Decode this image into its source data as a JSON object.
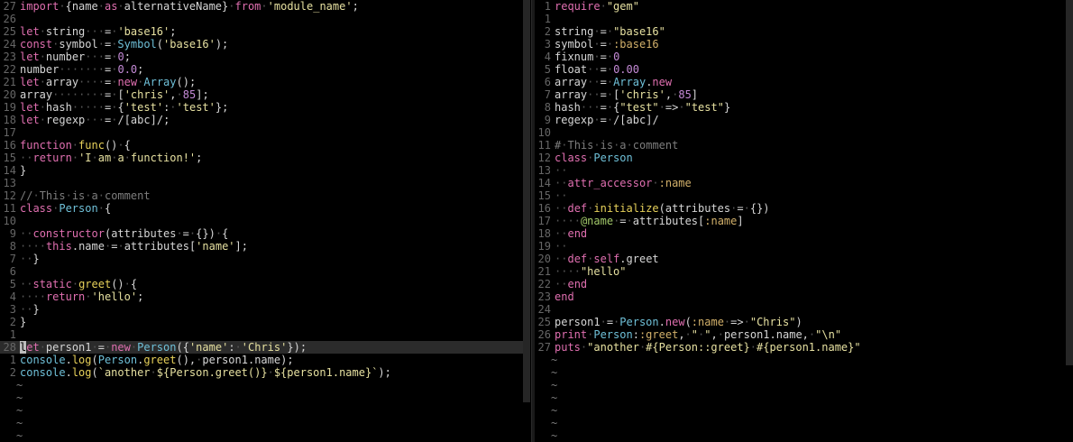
{
  "left_pane": {
    "lines": [
      {
        "n": "27",
        "t": "import·{name·as·alternativeName}·from·'module_name';"
      },
      {
        "n": "26",
        "t": ""
      },
      {
        "n": "25",
        "t": "let·string···=·'base16';"
      },
      {
        "n": "24",
        "t": "const·symbol·=·Symbol('base16');"
      },
      {
        "n": "23",
        "t": "let·number···=·0;"
      },
      {
        "n": "22",
        "t": "number·······=·0.0;"
      },
      {
        "n": "21",
        "t": "let·array····=·new·Array();"
      },
      {
        "n": "20",
        "t": "array········=·['chris',·85];"
      },
      {
        "n": "19",
        "t": "let·hash·····=·{'test':·'test'};"
      },
      {
        "n": "18",
        "t": "let·regexp···=·/[abc]/;"
      },
      {
        "n": "17",
        "t": ""
      },
      {
        "n": "16",
        "t": "function·func()·{"
      },
      {
        "n": "15",
        "t": "··return·'I·am·a·function!';"
      },
      {
        "n": "14",
        "t": "}"
      },
      {
        "n": "13",
        "t": ""
      },
      {
        "n": "12",
        "t": "//·This·is·a·comment"
      },
      {
        "n": "11",
        "t": "class·Person·{"
      },
      {
        "n": "10",
        "t": ""
      },
      {
        "n": "9",
        "t": "··constructor(attributes·=·{})·{"
      },
      {
        "n": "8",
        "t": "····this.name·=·attributes['name'];"
      },
      {
        "n": "7",
        "t": "··}"
      },
      {
        "n": "6",
        "t": ""
      },
      {
        "n": "5",
        "t": "··static·greet()·{"
      },
      {
        "n": "4",
        "t": "····return·'hello';"
      },
      {
        "n": "3",
        "t": "··}"
      },
      {
        "n": "2",
        "t": "}"
      },
      {
        "n": "1",
        "t": ""
      },
      {
        "n": "28",
        "t": "let·person1·=·new·Person({'name':·'Chris'});"
      },
      {
        "n": "1",
        "t": "console.log(Person.greet(),·person1.name);"
      },
      {
        "n": "2",
        "t": "console.log(`another·${Person.greet()}·${person1.name}`);"
      }
    ],
    "tildes": [
      "~",
      "~",
      "~",
      "~",
      "~"
    ]
  },
  "right_pane": {
    "lines": [
      {
        "n": "1",
        "t": "require·\"gem\""
      },
      {
        "n": "1",
        "t": ""
      },
      {
        "n": "2",
        "t": "string·=·\"base16\""
      },
      {
        "n": "3",
        "t": "symbol·=·:base16"
      },
      {
        "n": "4",
        "t": "fixnum·=·0"
      },
      {
        "n": "5",
        "t": "float··=·0.00"
      },
      {
        "n": "6",
        "t": "array··=·Array.new"
      },
      {
        "n": "7",
        "t": "array··=·['chris',·85]"
      },
      {
        "n": "8",
        "t": "hash···=·{\"test\"·=>·\"test\"}"
      },
      {
        "n": "9",
        "t": "regexp·=·/[abc]/"
      },
      {
        "n": "10",
        "t": ""
      },
      {
        "n": "11",
        "t": "#·This·is·a·comment"
      },
      {
        "n": "12",
        "t": "class·Person"
      },
      {
        "n": "13",
        "t": "··"
      },
      {
        "n": "14",
        "t": "··attr_accessor·:name"
      },
      {
        "n": "15",
        "t": "··"
      },
      {
        "n": "16",
        "t": "··def·initialize(attributes·=·{})"
      },
      {
        "n": "17",
        "t": "····@name·=·attributes[:name]"
      },
      {
        "n": "18",
        "t": "··end"
      },
      {
        "n": "19",
        "t": "··"
      },
      {
        "n": "20",
        "t": "··def·self.greet"
      },
      {
        "n": "21",
        "t": "····\"hello\""
      },
      {
        "n": "22",
        "t": "··end"
      },
      {
        "n": "23",
        "t": "end"
      },
      {
        "n": "24",
        "t": ""
      },
      {
        "n": "25",
        "t": "person1·=·Person.new(:name·=>·\"Chris\")"
      },
      {
        "n": "26",
        "t": "print·Person::greet,·\"·\",·person1.name,·\"\\n\""
      },
      {
        "n": "27",
        "t": "puts·\"another·#{Person::greet}·#{person1.name}\""
      }
    ],
    "tildes": [
      "~",
      "~",
      "~",
      "~",
      "~",
      "~",
      "~",
      "~"
    ]
  },
  "colors": {
    "keyword": "#e06fb0",
    "function": "#e7d15a",
    "string": "#e6e0a0",
    "number": "#c48ad6",
    "comment": "#7d7d7d"
  }
}
